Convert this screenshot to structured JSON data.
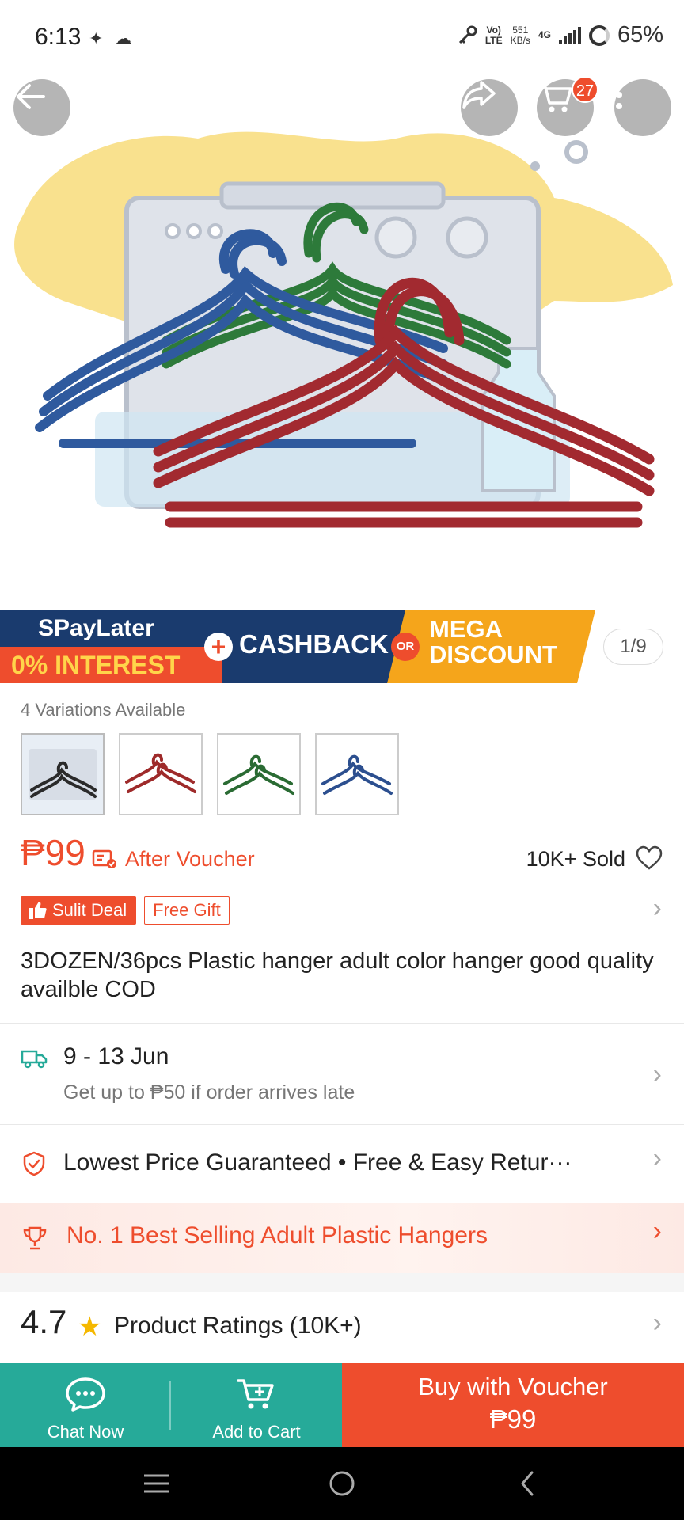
{
  "status_bar": {
    "time": "6:13",
    "left_icons": "✦ ☁",
    "volte_top": "Vo)",
    "volte_bottom": "LTE",
    "speed_top": "551",
    "speed_bottom": "KB/s",
    "network": "4G",
    "battery": "65%"
  },
  "header": {
    "cart_count": "27"
  },
  "promo": {
    "spay": "SPayLater",
    "interest": "0% INTEREST",
    "plus": "+",
    "cashback": "CASHBACK",
    "or": "OR",
    "mega1": "MEGA",
    "mega2": "DISCOUNT",
    "pager": "1/9"
  },
  "variations": {
    "label": "4 Variations Available",
    "colors": [
      "#2a2a2a",
      "#9e2a2a",
      "#2a6b33",
      "#2c4f8f"
    ]
  },
  "price": {
    "value": "₱99",
    "after_voucher": "After Voucher",
    "sold": "10K+ Sold"
  },
  "badges": {
    "deal": "Sulit Deal",
    "gift": "Free Gift"
  },
  "product": {
    "title": "3DOZEN/36pcs Plastic hanger adult color hanger good quality availble COD"
  },
  "shipping": {
    "date": "9 - 13 Jun",
    "note": "Get up to ₱50 if order arrives late"
  },
  "guarantee": {
    "text": "Lowest Price Guaranteed  •  Free & Easy Retur···"
  },
  "best_selling": {
    "text": "No. 1 Best Selling Adult Plastic Hangers"
  },
  "rating": {
    "score": "4.7",
    "label": "Product Ratings (10K+)"
  },
  "actions": {
    "chat": "Chat Now",
    "add_to_cart": "Add to Cart",
    "buy_line1": "Buy with Voucher",
    "buy_line2": "₱99"
  },
  "colors": {
    "accent": "#ee4d2d",
    "teal": "#26aa99"
  }
}
